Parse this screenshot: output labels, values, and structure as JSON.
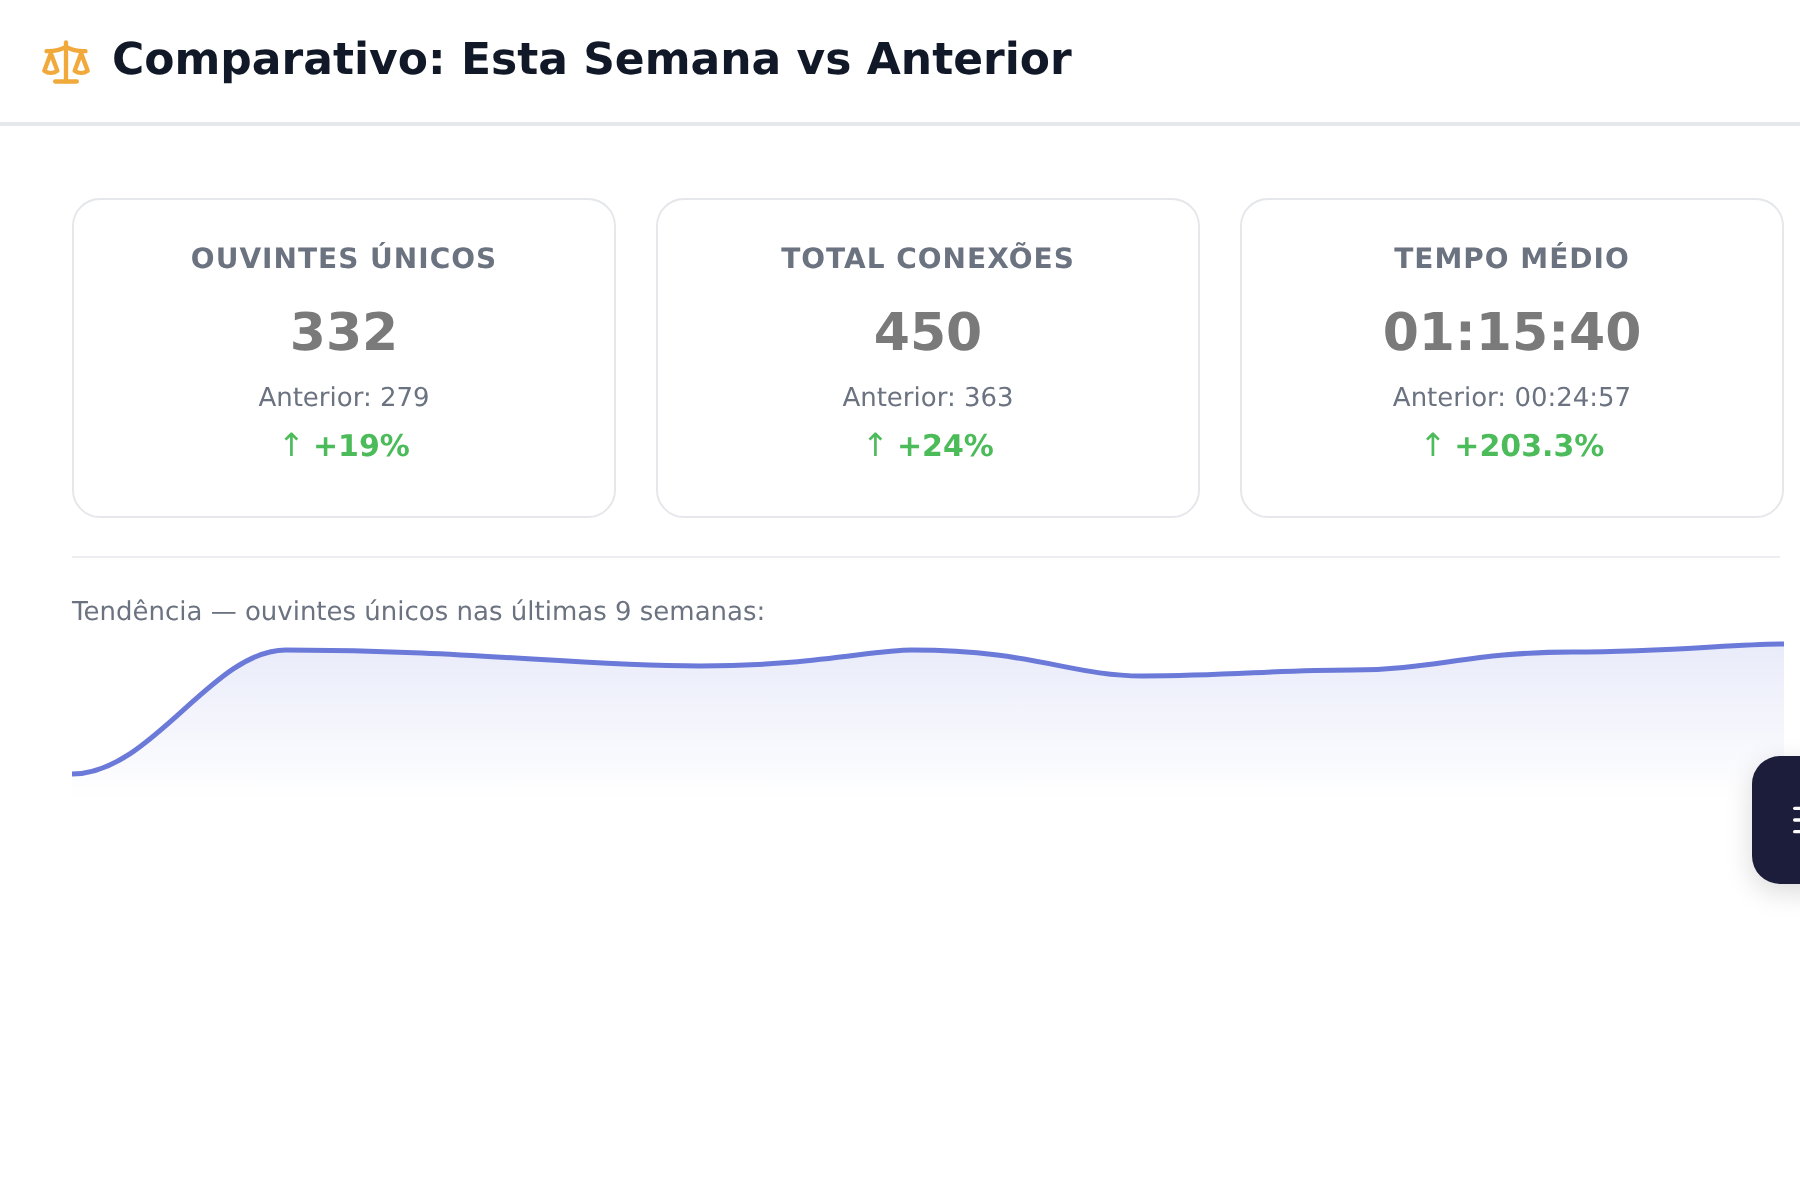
{
  "header": {
    "title": "Comparativo: Esta Semana vs Anterior"
  },
  "cards": [
    {
      "label": "OUVINTES ÚNICOS",
      "value": "332",
      "previous": "Anterior: 279",
      "arrow": "↑",
      "change": "+19%"
    },
    {
      "label": "TOTAL CONEXÕES",
      "value": "450",
      "previous": "Anterior: 363",
      "arrow": "↑",
      "change": "+24%"
    },
    {
      "label": "TEMPO MÉDIO",
      "value": "01:15:40",
      "previous": "Anterior: 00:24:57",
      "arrow": "↑",
      "change": "+203.3%"
    }
  ],
  "trend": {
    "caption": "Tendência — ouvintes únicos nas últimas 9 semanas:"
  }
}
